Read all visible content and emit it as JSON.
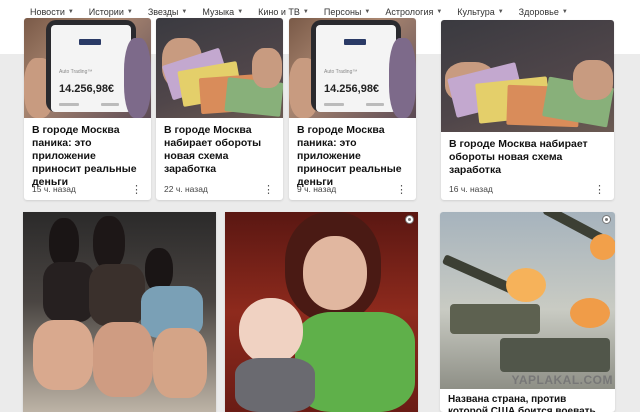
{
  "nav": {
    "items": [
      {
        "label": "Новости"
      },
      {
        "label": "Истории"
      },
      {
        "label": "Звезды"
      },
      {
        "label": "Музыка"
      },
      {
        "label": "Кино и ТВ"
      },
      {
        "label": "Персоны"
      },
      {
        "label": "Астрология"
      },
      {
        "label": "Культура"
      },
      {
        "label": "Здоровье"
      }
    ],
    "caret_icon": "chevron-down-icon"
  },
  "cards": [
    {
      "title": "В городе Москва паника: это приложение приносит реальные деньги",
      "time": "15 ч. назад",
      "phone_amount": "14.256,98€",
      "phone_text": "Auto Trading™"
    },
    {
      "title": "В городе Москва набирает обороты новая схема заработка",
      "time": "22 ч. назад"
    },
    {
      "title": "В городе Москва паника: это приложение приносит реальные деньги",
      "time": "9 ч. назад",
      "phone_amount": "14.256,98€",
      "phone_text": "Auto Trading™"
    },
    {
      "title": "В городе Москва набирает обороты новая схема заработка",
      "time": "16 ч. назад"
    },
    {
      "title": "Названа страна, против которой США боится воевать"
    }
  ],
  "watermark": "YAPLAKAL.COM",
  "colors": {
    "background": "#ebebeb",
    "card": "#ffffff",
    "text": "#111111",
    "meta": "#444444"
  }
}
